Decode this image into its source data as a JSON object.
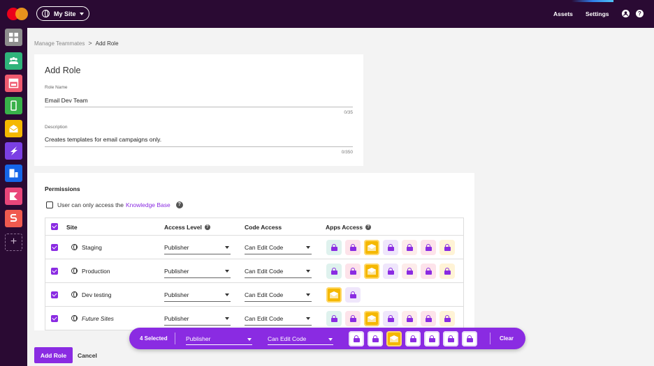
{
  "topbar": {
    "site_switcher": "My Site",
    "assets": "Assets",
    "settings": "Settings",
    "help": "?"
  },
  "sidebar": {
    "items": [
      {
        "name": "dashboard-icon",
        "color": "#8e8e8e"
      },
      {
        "name": "teammates-icon",
        "color": "#2fb37a"
      },
      {
        "name": "web-studio-icon",
        "color": "#ef5a6f"
      },
      {
        "name": "mobile-icon",
        "color": "#38b14a"
      },
      {
        "name": "email-icon",
        "color": "#f5b800"
      },
      {
        "name": "accelerate-icon",
        "color": "#7b3fe4"
      },
      {
        "name": "blocks-icon",
        "color": "#1565e8"
      },
      {
        "name": "forms-icon",
        "color": "#e9467a"
      },
      {
        "name": "sparkpost-icon",
        "color": "#f05a4f"
      }
    ],
    "add": "+"
  },
  "breadcrumb": {
    "parent": "Manage Teammates",
    "separator": ">",
    "current": "Add Role"
  },
  "form": {
    "title": "Add Role",
    "role_name_label": "Role Name",
    "role_name_value": "Email Dev Team",
    "role_name_count": "0/35",
    "description_label": "Description",
    "description_value": "Creates templates for email campaigns only.",
    "description_count": "0/350"
  },
  "permissions": {
    "title": "Permissions",
    "kb_text": "User can only access the",
    "kb_link": "Knowledge Base",
    "help": "?",
    "columns": {
      "site": "Site",
      "access_level": "Access Level",
      "code_access": "Code Access",
      "apps_access": "Apps Access"
    },
    "rows": [
      {
        "site": "Staging",
        "access": "Publisher",
        "code": "Can Edit Code",
        "apps": "full"
      },
      {
        "site": "Production",
        "access": "Publisher",
        "code": "Can Edit Code",
        "apps": "full"
      },
      {
        "site": "Dev testing",
        "access": "Publisher",
        "code": "Can Edit Code",
        "apps": "short"
      },
      {
        "site": "Future Sites",
        "access": "Publisher",
        "code": "Can Edit Code",
        "apps": "full"
      }
    ]
  },
  "app_tiles": {
    "full": [
      "#dff2ee",
      "#fde3ea",
      "email",
      "#efe6fb",
      "#fdecea",
      "#fde3ea",
      "#fff3d6"
    ],
    "short": [
      "email",
      "#efe6fb"
    ]
  },
  "selection_bar": {
    "count": "4 Selected",
    "access": "Publisher",
    "code": "Can Edit Code",
    "clear": "Clear"
  },
  "actions": {
    "add_role": "Add Role",
    "cancel": "Cancel"
  },
  "colors": {
    "brand": "#8a2be2",
    "nav_bg": "#2a0a33"
  }
}
